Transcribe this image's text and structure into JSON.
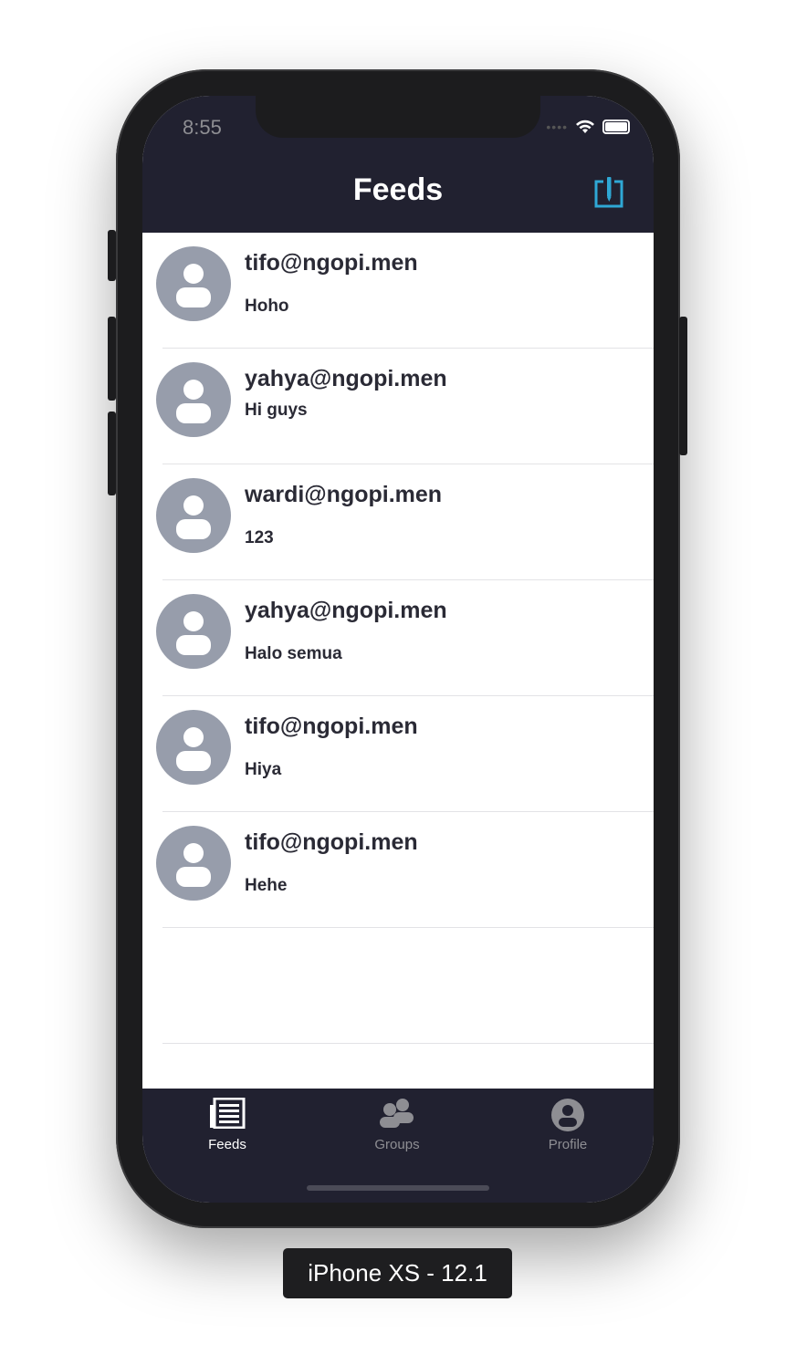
{
  "status_bar": {
    "time": "8:55"
  },
  "nav": {
    "title": "Feeds",
    "compose_icon": "compose-icon",
    "accent": "#2fa8d5"
  },
  "feeds": [
    {
      "user": "tifo@ngopi.men",
      "message": "Hoho"
    },
    {
      "user": "yahya@ngopi.men",
      "message": "Hi guys"
    },
    {
      "user": "wardi@ngopi.men",
      "message": "123"
    },
    {
      "user": "yahya@ngopi.men",
      "message": "Halo semua"
    },
    {
      "user": "tifo@ngopi.men",
      "message": "Hiya"
    },
    {
      "user": "tifo@ngopi.men",
      "message": "Hehe"
    }
  ],
  "tabs": [
    {
      "label": "Feeds",
      "icon": "feeds-icon",
      "active": true
    },
    {
      "label": "Groups",
      "icon": "groups-icon",
      "active": false
    },
    {
      "label": "Profile",
      "icon": "profile-icon",
      "active": false
    }
  ],
  "colors": {
    "nav_bg": "#212130",
    "avatar": "#979dab",
    "tab_active": "#ffffff",
    "tab_inactive": "#8e8e93"
  },
  "device_caption": "iPhone XS - 12.1"
}
